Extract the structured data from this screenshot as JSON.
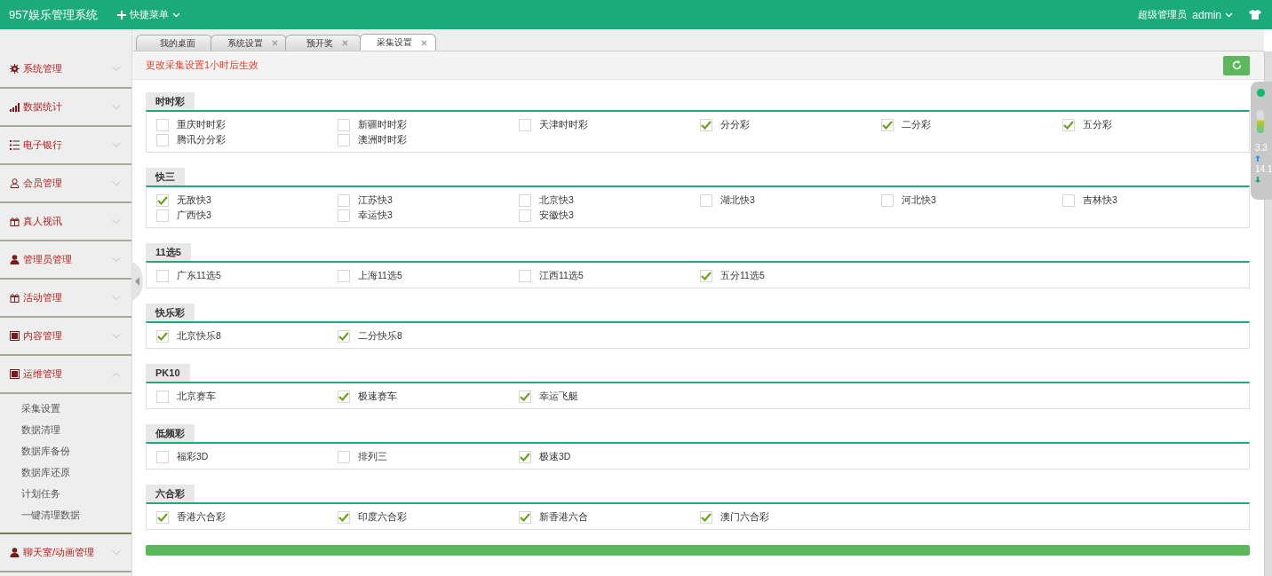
{
  "header": {
    "title": "957娱乐管理系统",
    "quick_menu": "快捷菜单",
    "role": "超级管理员",
    "user": "admin"
  },
  "sidebar": {
    "items": [
      {
        "label": "系统管理",
        "expanded": false
      },
      {
        "label": "数据统计",
        "expanded": false
      },
      {
        "label": "电子银行",
        "expanded": false
      },
      {
        "label": "会员管理",
        "expanded": false
      },
      {
        "label": "真人视讯",
        "expanded": false
      },
      {
        "label": "管理员管理",
        "expanded": false
      },
      {
        "label": "活动管理",
        "expanded": false
      },
      {
        "label": "内容管理",
        "expanded": false
      },
      {
        "label": "运维管理",
        "expanded": true,
        "children": [
          {
            "label": "采集设置"
          },
          {
            "label": "数据清理"
          },
          {
            "label": "数据库备份"
          },
          {
            "label": "数据库还原"
          },
          {
            "label": "计划任务"
          },
          {
            "label": "一键清理数据"
          }
        ]
      },
      {
        "label": "聊天室/动画管理",
        "expanded": false
      }
    ]
  },
  "tabs": [
    {
      "label": "我的桌面",
      "closable": false,
      "selected": false
    },
    {
      "label": "系统设置",
      "closable": true,
      "selected": false
    },
    {
      "label": "预开奖",
      "closable": true,
      "selected": false
    },
    {
      "label": "采集设置",
      "closable": true,
      "selected": true
    }
  ],
  "notice": "更改采集设置1小时后生效",
  "groups": [
    {
      "title": "时时彩",
      "items": [
        {
          "label": "重庆时时彩",
          "checked": false
        },
        {
          "label": "新疆时时彩",
          "checked": false
        },
        {
          "label": "天津时时彩",
          "checked": false
        },
        {
          "label": "分分彩",
          "checked": true
        },
        {
          "label": "二分彩",
          "checked": true
        },
        {
          "label": "五分彩",
          "checked": true
        },
        {
          "label": "腾讯分分彩",
          "checked": false
        },
        {
          "label": "澳洲时时彩",
          "checked": false
        }
      ]
    },
    {
      "title": "快三",
      "items": [
        {
          "label": "无敌快3",
          "checked": true
        },
        {
          "label": "江苏快3",
          "checked": false
        },
        {
          "label": "北京快3",
          "checked": false
        },
        {
          "label": "湖北快3",
          "checked": false
        },
        {
          "label": "河北快3",
          "checked": false
        },
        {
          "label": "吉林快3",
          "checked": false
        },
        {
          "label": "广西快3",
          "checked": false
        },
        {
          "label": "幸运快3",
          "checked": false
        },
        {
          "label": "安徽快3",
          "checked": false
        }
      ]
    },
    {
      "title": "11选5",
      "items": [
        {
          "label": "广东11选5",
          "checked": false
        },
        {
          "label": "上海11选5",
          "checked": false
        },
        {
          "label": "江西11选5",
          "checked": false
        },
        {
          "label": "五分11选5",
          "checked": true
        }
      ]
    },
    {
      "title": "快乐彩",
      "items": [
        {
          "label": "北京快乐8",
          "checked": true
        },
        {
          "label": "二分快乐8",
          "checked": true
        }
      ]
    },
    {
      "title": "PK10",
      "items": [
        {
          "label": "北京赛车",
          "checked": false
        },
        {
          "label": "极速赛车",
          "checked": true
        },
        {
          "label": "幸运飞艇",
          "checked": true
        }
      ]
    },
    {
      "title": "低频彩",
      "items": [
        {
          "label": "福彩3D",
          "checked": false
        },
        {
          "label": "排列三",
          "checked": false
        },
        {
          "label": "极速3D",
          "checked": true
        }
      ]
    },
    {
      "title": "六合彩",
      "items": [
        {
          "label": "香港六合彩",
          "checked": true
        },
        {
          "label": "印度六合彩",
          "checked": true
        },
        {
          "label": "新香港六合",
          "checked": true
        },
        {
          "label": "澳门六合彩",
          "checked": true
        }
      ]
    }
  ],
  "speed_widget": {
    "upload": "3.3",
    "download": "14.1"
  }
}
